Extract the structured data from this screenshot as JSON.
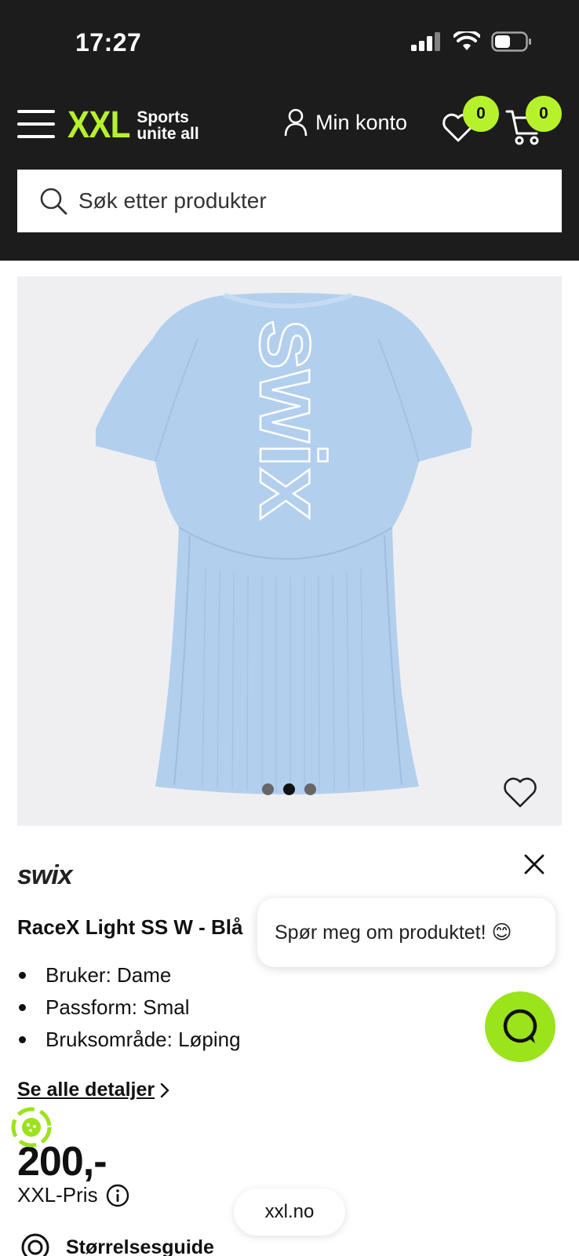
{
  "status_bar": {
    "time": "17:27"
  },
  "header": {
    "logo_text": "XXL",
    "logo_tagline_1": "Sports",
    "logo_tagline_2": "unite all",
    "account_label": "Min konto",
    "wishlist_count": "0",
    "cart_count": "0",
    "search_placeholder": "Søk etter produkter"
  },
  "product": {
    "image_brand_print": "swix",
    "carousel_slides": 3,
    "carousel_active_index": 1,
    "brand": "swix",
    "title": "RaceX Light SS W - Blå",
    "features": [
      "Bruker: Dame",
      "Passform: Smal",
      "Bruksområde: Løping"
    ],
    "details_link": "Se alle detaljer",
    "price": "200,-",
    "price_label": "XXL-Pris",
    "size_guide": "Størrelsesguide"
  },
  "chat": {
    "prompt": "Spør meg om produktet! 😊"
  },
  "browser": {
    "url": "xxl.no"
  },
  "colors": {
    "accent": "#b6f22b",
    "header_bg": "#1c1c1c",
    "chat_green": "#9be31b",
    "shirt": "#b3cfee"
  }
}
